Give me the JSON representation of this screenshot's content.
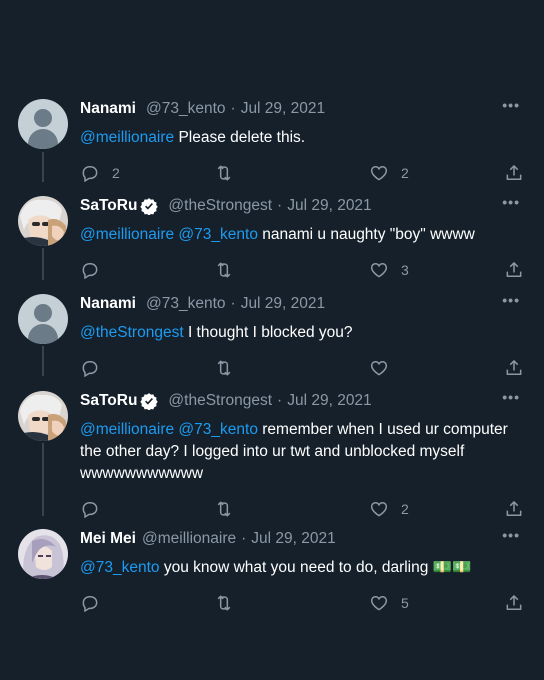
{
  "tweets": [
    {
      "name": "Nanami",
      "handle": "@73_kento",
      "date": "Jul 29, 2021",
      "verified": false,
      "avatar": "default-avatar",
      "mentions": "@meillionaire",
      "text": " Please delete this.",
      "replies": "2",
      "retweets": "",
      "likes": "2"
    },
    {
      "name": "SaToRu",
      "handle": "@theStrongest",
      "date": "Jul 29, 2021",
      "verified": true,
      "avatar": "anime-avatar-satoru",
      "mentions": "@meillionaire @73_kento",
      "text": " nanami u naughty \"boy\" wwww",
      "replies": "",
      "retweets": "",
      "likes": "3"
    },
    {
      "name": "Nanami",
      "handle": "@73_kento",
      "date": "Jul 29, 2021",
      "verified": false,
      "avatar": "default-avatar",
      "mentions": "@theStrongest",
      "text": " I thought I blocked you?",
      "replies": "",
      "retweets": "",
      "likes": ""
    },
    {
      "name": "SaToRu",
      "handle": "@theStrongest",
      "date": "Jul 29, 2021",
      "verified": true,
      "avatar": "anime-avatar-satoru",
      "mentions": "@meillionaire @73_kento",
      "text": " remember when I used ur computer the other day? I logged into ur twt and unblocked myself wwwwwwwwwww",
      "replies": "",
      "retweets": "",
      "likes": "2"
    },
    {
      "name": "Mei Mei",
      "handle": "@meillionaire",
      "date": "Jul 29, 2021",
      "verified": false,
      "avatar": "anime-avatar-meimei",
      "mentions": "@73_kento",
      "text": " you know what you need to do, darling 💵💵",
      "replies": "",
      "retweets": "",
      "likes": "5"
    }
  ],
  "ui": {
    "dot": "·",
    "more": "•••"
  },
  "colors": {
    "background": "#15202b",
    "mention": "#1d9bf0",
    "muted": "#8b98a5",
    "verified": "#ffffff"
  }
}
